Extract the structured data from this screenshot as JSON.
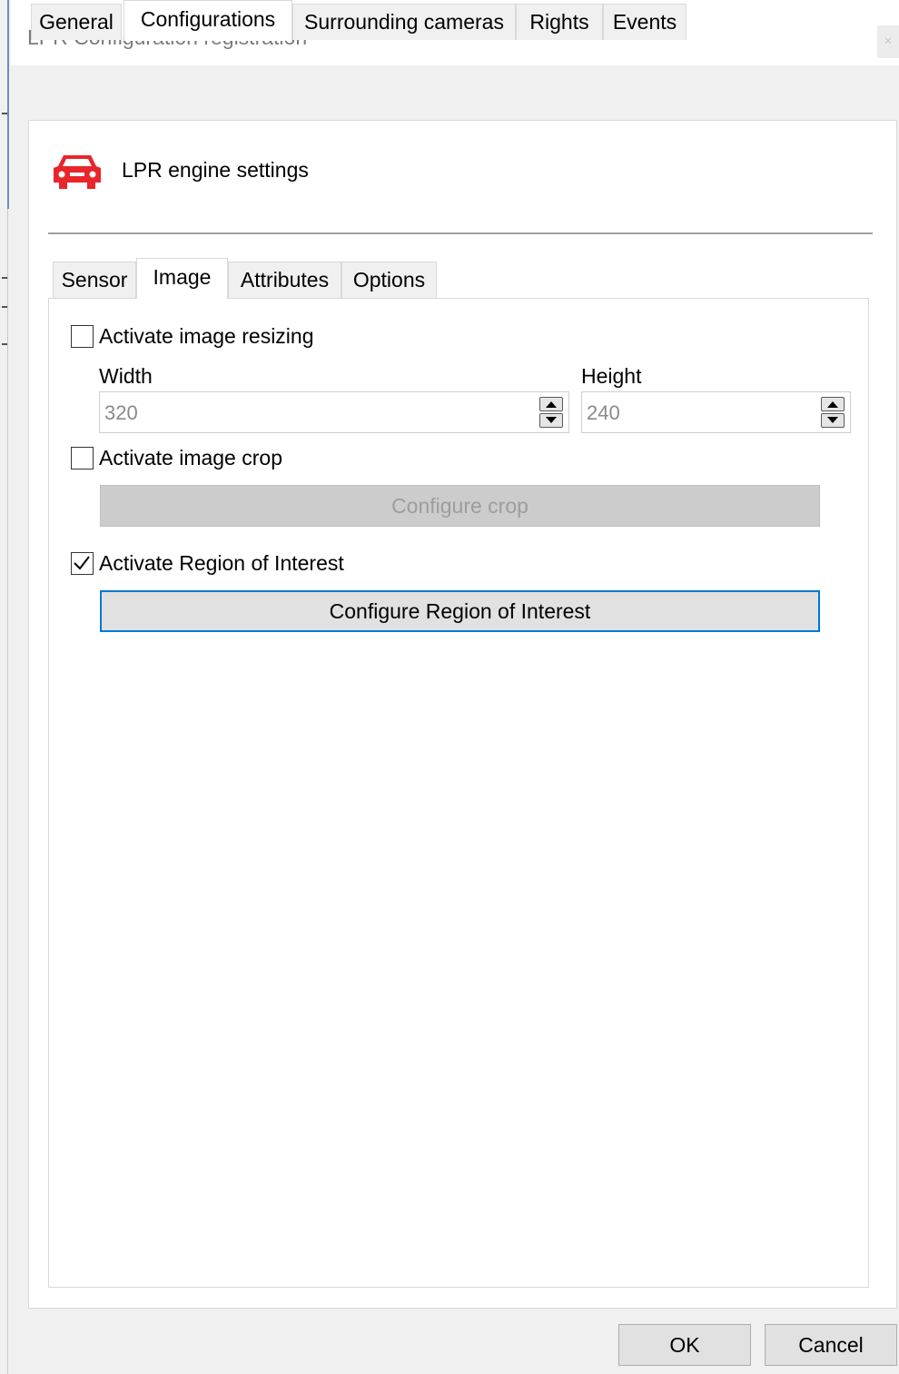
{
  "window": {
    "title": "LPR Configuration registration",
    "close_glyph": "×"
  },
  "outer_tabs": [
    {
      "label": "General"
    },
    {
      "label": "Configurations"
    },
    {
      "label": "Surrounding cameras"
    },
    {
      "label": "Rights"
    },
    {
      "label": "Events"
    }
  ],
  "section": {
    "title": "LPR engine settings",
    "icon": "car-icon",
    "icon_color": "#e8262b"
  },
  "inner_tabs": [
    {
      "label": "Sensor"
    },
    {
      "label": "Image"
    },
    {
      "label": "Attributes"
    },
    {
      "label": "Options"
    }
  ],
  "image_tab": {
    "resize": {
      "checkbox_label": "Activate image resizing",
      "checked": false,
      "width_label": "Width",
      "width_value": "320",
      "height_label": "Height",
      "height_value": "240"
    },
    "crop": {
      "checkbox_label": "Activate image crop",
      "checked": false,
      "button_label": "Configure crop"
    },
    "roi": {
      "checkbox_label": "Activate Region of Interest",
      "checked": true,
      "button_label": "Configure Region of Interest"
    }
  },
  "footer": {
    "ok_label": "OK",
    "cancel_label": "Cancel"
  },
  "colors": {
    "focus_border": "#0078d7",
    "disabled_text": "#9d9d9d"
  }
}
